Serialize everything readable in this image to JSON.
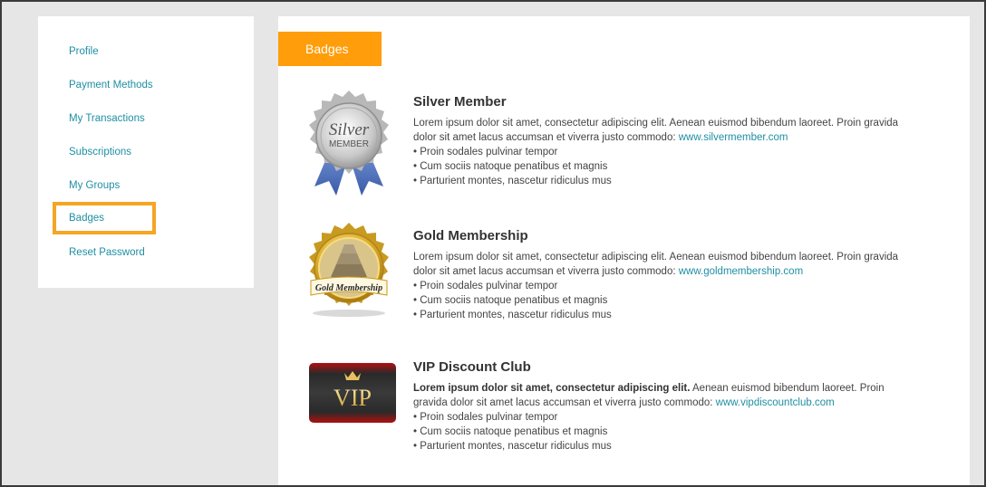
{
  "sidebar": {
    "items": [
      {
        "label": "Profile"
      },
      {
        "label": "Payment Methods"
      },
      {
        "label": "My Transactions"
      },
      {
        "label": "Subscriptions"
      },
      {
        "label": "My Groups"
      },
      {
        "label": "Badges"
      },
      {
        "label": "Reset Password"
      }
    ],
    "active_color": "#f5a623",
    "link_color": "#1f8fa3"
  },
  "main": {
    "tab_label": "Badges",
    "tab_color": "#ff9d0a",
    "badges": [
      {
        "title": "Silver Member",
        "desc_bold": "",
        "desc": "Lorem ipsum dolor sit amet, consectetur adipiscing elit. Aenean euismod bibendum laoreet. Proin gravida dolor sit amet lacus accumsan et viverra justo commodo: ",
        "link": "www.silvermember.com",
        "bullets": [
          "• Proin sodales pulvinar tempor",
          "• Cum sociis natoque penatibus et magnis",
          "• Parturient montes, nascetur ridiculus mus"
        ],
        "image_text": {
          "line1": "Silver",
          "line2": "MEMBER"
        },
        "icon": "silver-medal-icon"
      },
      {
        "title": "Gold Membership",
        "desc_bold": "",
        "desc": "Lorem ipsum dolor sit amet, consectetur adipiscing elit. Aenean euismod bibendum laoreet. Proin gravida dolor sit amet lacus accumsan et viverra justo commodo: ",
        "link": "www.goldmembership.com",
        "bullets": [
          "• Proin sodales pulvinar tempor",
          "• Cum sociis natoque penatibus et magnis",
          "• Parturient montes, nascetur ridiculus mus"
        ],
        "image_text": {
          "line1": "Gold Membership"
        },
        "icon": "gold-medal-icon"
      },
      {
        "title": "VIP Discount Club",
        "desc_bold": "Lorem ipsum dolor sit amet, consectetur adipiscing elit.",
        "desc": " Aenean euismod bibendum laoreet. Proin gravida dolor sit amet lacus accumsan et viverra justo commodo: ",
        "link": "www.vipdiscountclub.com",
        "bullets": [
          "• Proin sodales pulvinar tempor",
          "• Cum sociis natoque penatibus et magnis",
          "• Parturient montes, nascetur ridiculus mus"
        ],
        "image_text": {
          "line1": "VIP"
        },
        "icon": "vip-card-icon"
      }
    ]
  }
}
